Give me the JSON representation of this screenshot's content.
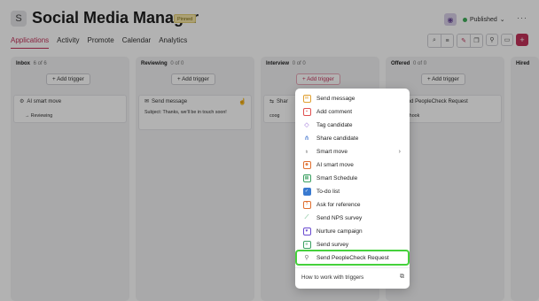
{
  "header": {
    "app_initial": "S",
    "title": "Social Media Manager",
    "badge": "Pinned",
    "status": "Published",
    "status_color": "#3fae5a"
  },
  "tabs": [
    {
      "label": "Applications",
      "active": true
    },
    {
      "label": "Activity",
      "active": false
    },
    {
      "label": "Promote",
      "active": false
    },
    {
      "label": "Calendar",
      "active": false
    },
    {
      "label": "Analytics",
      "active": false
    }
  ],
  "toolbar_icons": [
    "search-icon",
    "filter-icon",
    "wand-icon",
    "copy-icon",
    "pin-icon",
    "chat-icon",
    "plus-icon"
  ],
  "colors": {
    "accent": "#c2325a",
    "highlight": "#45d13c"
  },
  "columns": [
    {
      "name": "Inbox",
      "count": "6 of 6",
      "add_trigger": "+ Add trigger",
      "cards": [
        {
          "title": "AI smart move",
          "sub": "→ Reviewing"
        }
      ]
    },
    {
      "name": "Reviewing",
      "count": "0 of 0",
      "add_trigger": "+ Add trigger",
      "cards": [
        {
          "title": "Send message",
          "body": "Subject: Thanks, we'll be in touch soon!"
        }
      ]
    },
    {
      "name": "Interview",
      "count": "0 of 0",
      "add_trigger": "+ Add trigger",
      "cards": [
        {
          "title": "Shar",
          "sub": "coog"
        }
      ]
    },
    {
      "name": "Offered",
      "count": "0 of 0",
      "add_trigger": "+ Add trigger",
      "cards": [
        {
          "title": "Send PeopleCheck Request",
          "sub": "Webhook"
        }
      ]
    },
    {
      "name": "Hired",
      "count": "",
      "add_trigger": "",
      "cards": []
    }
  ],
  "menu": {
    "items": [
      {
        "label": "Send message",
        "icon": "envelope-icon",
        "color": "#e0a030"
      },
      {
        "label": "Add comment",
        "icon": "comment-icon",
        "color": "#e05050"
      },
      {
        "label": "Tag candidate",
        "icon": "tag-icon",
        "color": "#8a5ad0"
      },
      {
        "label": "Share candidate",
        "icon": "share-icon",
        "color": "#4a7ad0"
      },
      {
        "label": "Smart move",
        "icon": "bulb-icon",
        "color": "#555555",
        "submenu": true
      },
      {
        "label": "AI smart move",
        "icon": "robot-icon",
        "color": "#e07030"
      },
      {
        "label": "Smart Schedule",
        "icon": "calendar-icon",
        "color": "#3aa060"
      },
      {
        "label": "To-do list",
        "icon": "checkbox-icon",
        "color": "#3a7ad0"
      },
      {
        "label": "Ask for reference",
        "icon": "question-icon",
        "color": "#e07030"
      },
      {
        "label": "Send NPS survey",
        "icon": "chart-icon",
        "color": "#3aa060"
      },
      {
        "label": "Nurture campaign",
        "icon": "heart-icon",
        "color": "#6a4ad0"
      },
      {
        "label": "Send survey",
        "icon": "list-icon",
        "color": "#3aa060"
      },
      {
        "label": "Send PeopleCheck Request",
        "icon": "webhook-icon",
        "color": "#777777",
        "highlighted": true
      }
    ],
    "footer": "How to work with triggers"
  }
}
